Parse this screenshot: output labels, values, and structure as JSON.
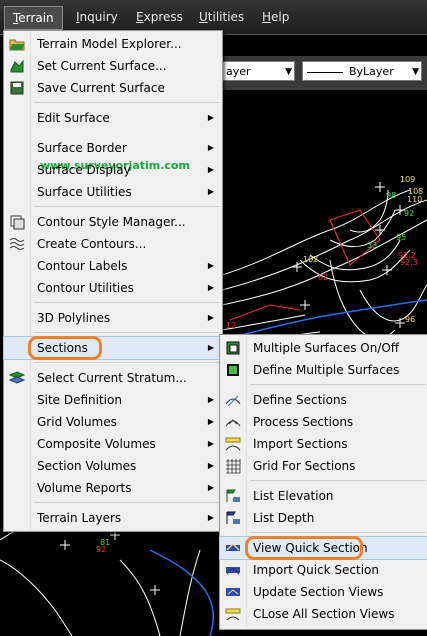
{
  "menubar": {
    "items": [
      {
        "label": "Terrain",
        "u": "T",
        "rest": "errain"
      },
      {
        "label": "Inquiry",
        "u": "I",
        "rest": "nquiry"
      },
      {
        "label": "Express",
        "u": "E",
        "rest": "xpress"
      },
      {
        "label": "Utilities",
        "u": "U",
        "rest": "tilities"
      },
      {
        "label": "Help",
        "u": "H",
        "rest": "elp"
      }
    ]
  },
  "toolbar": {
    "layer_value": "ayer",
    "linetype_value": "ByLayer"
  },
  "watermark": "www.surveyorjatim.com",
  "terrain_menu": {
    "items": [
      "Terrain Model Explorer...",
      "Set Current Surface...",
      "Save Current Surface",
      "Edit Surface",
      "Surface Border",
      "Surface Display",
      "Surface Utilities",
      "Contour Style Manager...",
      "Create Contours...",
      "Contour Labels",
      "Contour Utilities",
      "3D Polylines",
      "Sections",
      "Select Current Stratum...",
      "Site Definition",
      "Grid Volumes",
      "Composite Volumes",
      "Section Volumes",
      "Volume Reports",
      "Terrain Layers"
    ]
  },
  "sections_menu": {
    "items": [
      "Multiple Surfaces On/Off",
      "Define Multiple Surfaces",
      "Define Sections",
      "Process Sections",
      "Import Sections",
      "Grid For Sections",
      "List Elevation",
      "List Depth",
      "View Quick Section",
      "Import Quick Section",
      "Update Section Views",
      "CLose All Section Views"
    ]
  },
  "drawing_labels": [
    "109",
    "98",
    "108",
    "110",
    "92",
    "95",
    "102",
    "92.2",
    "62",
    "92.3",
    "33",
    "96",
    "12",
    "81",
    "92"
  ],
  "colors": {
    "highlight_circle": "#f07f2a",
    "watermark": "#1aa83a",
    "menu_bg": "#f0f0f0"
  }
}
